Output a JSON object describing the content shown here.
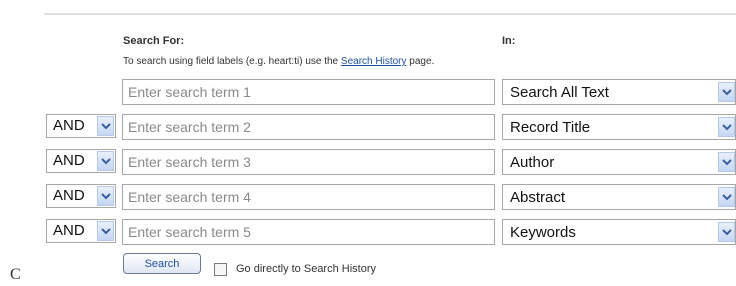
{
  "labels": {
    "search_for": "Search For:",
    "in": "In:",
    "hint_before": "To search using field labels (e.g. heart:ti) use the ",
    "hint_link": "Search History",
    "hint_after": " page."
  },
  "rows": [
    {
      "operator": "",
      "placeholder": "Enter search term 1",
      "field": "Search All Text"
    },
    {
      "operator": "AND",
      "placeholder": "Enter search term 2",
      "field": "Record Title"
    },
    {
      "operator": "AND",
      "placeholder": "Enter search term 3",
      "field": "Author"
    },
    {
      "operator": "AND",
      "placeholder": "Enter search term 4",
      "field": "Abstract"
    },
    {
      "operator": "AND",
      "placeholder": "Enter search term 5",
      "field": "Keywords"
    }
  ],
  "icons": {
    "dropdown": "chevron-down-icon"
  },
  "footer": {
    "clipped_text": "C",
    "search_button": "Search",
    "checkbox_label": "Go directly to Search History"
  }
}
